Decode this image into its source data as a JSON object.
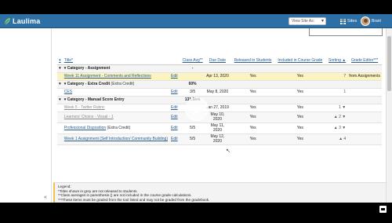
{
  "app": {
    "name": "Laulima"
  },
  "topnav": {
    "view_site_as": "View Site As:",
    "sites_label": "Sites",
    "user_name": "Brant"
  },
  "table": {
    "headers": {
      "title": "Title*",
      "class_avg": "Class Avg**",
      "due_date": "Due Date",
      "released": "Released to Students",
      "course_grade": "Included in Course Grade",
      "sorting": "Sorting ▲",
      "grade_editor": "Grade Editor***"
    },
    "rows": [
      {
        "kind": "cat",
        "title": "Category - Assignment",
        "avg": "-"
      },
      {
        "kind": "item",
        "style": "hl",
        "title": "Week 11 Assignment - Comments and Reflections",
        "edit": "Edit",
        "avg": "",
        "due": "Apr 13, 2020",
        "released": "Yes",
        "cg": "Yes",
        "sort": "7",
        "ge": "from Assignments"
      },
      {
        "kind": "cat",
        "title": "Category - Extra Credit",
        "sub": " (Extra Credit)",
        "avg": "60%"
      },
      {
        "kind": "item",
        "style": "",
        "title": "CES",
        "edit": "Edit",
        "avg": "3/5",
        "due": "May 8, 2020",
        "released": "Yes",
        "cg": "Yes",
        "sort": "1",
        "ge": ""
      },
      {
        "kind": "cat",
        "title": "Category - Manual Score Entry",
        "avg": "131.66%"
      },
      {
        "kind": "item",
        "style": "",
        "title": "Week 5 - Twitter Rubric",
        "muted": true,
        "edit": "Edit",
        "avg": "",
        "due": "Jan 27, 2019",
        "released": "Yes",
        "cg": "Yes",
        "sort": "1 ▼",
        "ge": ""
      },
      {
        "kind": "item",
        "style": "alt",
        "title": "Learners' Choice - Visual - 1",
        "muted": true,
        "edit": "Edit",
        "avg": "",
        "due": "May 10, 2020",
        "released": "Yes",
        "cg": "Yes",
        "sort": "▲ 2 ▼",
        "ge": ""
      },
      {
        "kind": "item",
        "style": "",
        "title": "Professional Disposition",
        "sub": " (Extra Credit)",
        "edit": "Edit",
        "avg": "5/5",
        "due": "May 11, 2020",
        "released": "Yes",
        "cg": "Yes",
        "sort": "▲ 3 ▼",
        "ge": ""
      },
      {
        "kind": "item",
        "style": "alt",
        "title": "Week 1 Assignment (Self Introduction/ Community Building)",
        "edit": "Edit",
        "avg": "5/5",
        "due": "May 12, 2020",
        "released": "Yes",
        "cg": "Yes",
        "sort": "▲ 4",
        "ge": ""
      }
    ]
  },
  "legend": {
    "title": "Legend:",
    "line1": "*Titles shown in grey are not released to students.",
    "line2": "**Class averages in parenthesis () are not included in the course grade calculations.",
    "line3": "***These items must be graded from the tool listed and may not be graded from the gradebook."
  },
  "sidebar": {
    "collapse_icon": "«"
  },
  "colors": {
    "nav": "#2e6fa6",
    "highlight_row": "#fbf3c0",
    "link": "#2b5e8c"
  }
}
